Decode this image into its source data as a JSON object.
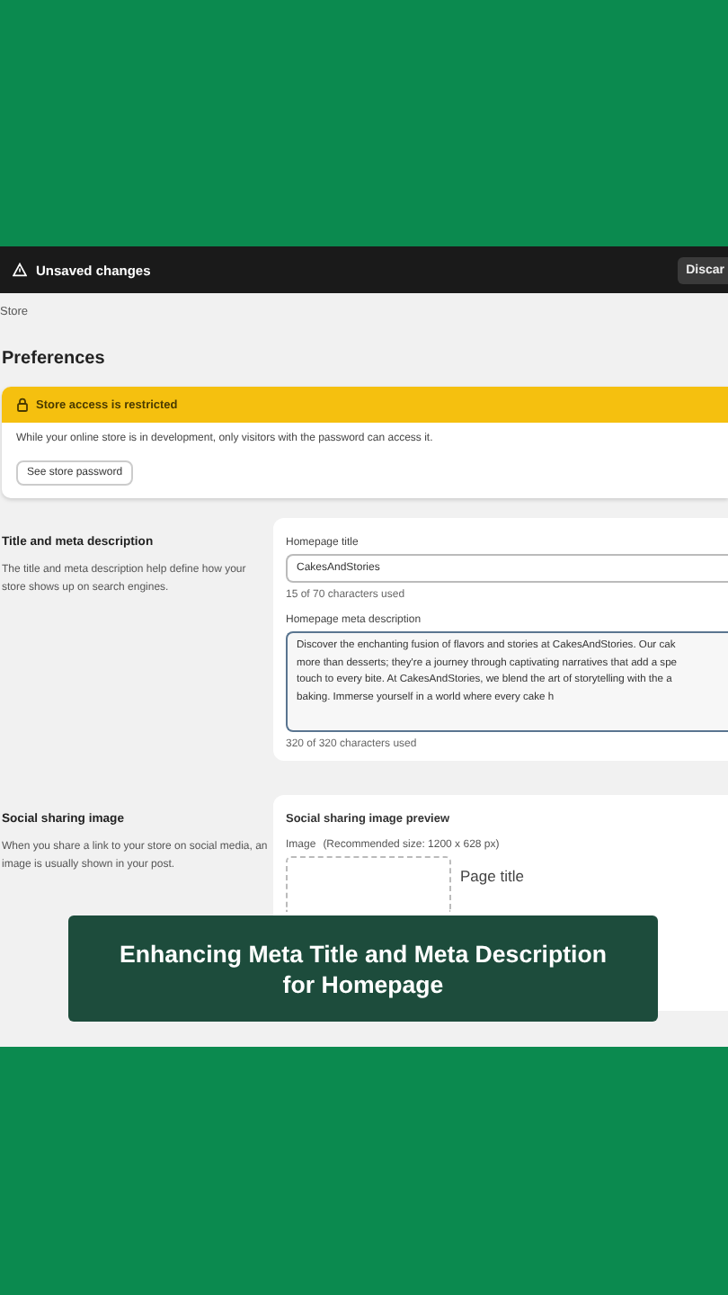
{
  "save_bar": {
    "title": "Unsaved changes",
    "discard_button": "Discar"
  },
  "breadcrumb": "Store",
  "page_title": "Preferences",
  "banner": {
    "title": "Store access is restricted",
    "message": "While your online store is in development, only visitors with the password can access it.",
    "button": "See store password"
  },
  "title_section": {
    "heading": "Title and meta description",
    "description": "The title and meta description help define how your store shows up on search engines.",
    "title_field": {
      "label": "Homepage title",
      "value": "CakesAndStories",
      "help": "15 of 70 characters used"
    },
    "meta_field": {
      "label": "Homepage meta description",
      "focused": true,
      "value_lines": [
        "Discover the enchanting fusion of flavors and stories at CakesAndStories. Our cak",
        "more than desserts; they're a journey through captivating narratives that add a spe",
        "touch to every bite. At CakesAndStories, we blend the art of storytelling with the a",
        "baking. Immerse yourself in a world where every cake h"
      ],
      "help": "320 of 320 characters used"
    }
  },
  "social_section": {
    "heading": "Social sharing image",
    "description": "When you share a link to your store on social media, an image is usually shown in your post.",
    "preview_title": "Social sharing image preview",
    "image_label": "Image",
    "image_hint": "(Recommended size: 1200 x 628 px)",
    "page_title": "Page title"
  },
  "caption": {
    "line_1": "Enhancing Meta Title and Meta Description",
    "line_2": "for Homepage"
  }
}
